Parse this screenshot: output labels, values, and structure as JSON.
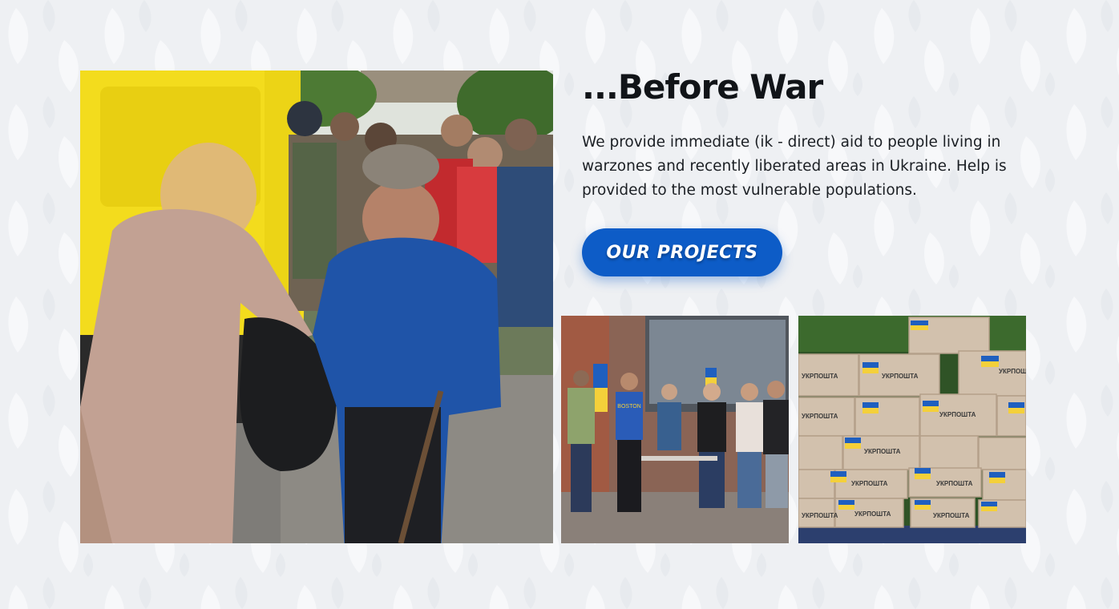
{
  "section": {
    "heading": "...Before War",
    "description": "We provide immediate (ik - direct) aid to people living in warzones and recently liberated areas in Ukraine. Help is provided to the most vulnerable populations.",
    "cta_label": "OUR PROJECTS"
  },
  "photos": {
    "team_shirt_text": "BOSTON",
    "box_label": "УКРПОШТА"
  },
  "colors": {
    "background": "#eef0f3",
    "heading": "#111418",
    "body_text": "#1b1f24",
    "button": "#0d5cc7",
    "button_text": "#ffffff",
    "ukraine_blue": "#1f5fbf",
    "ukraine_yellow": "#f4d03a"
  }
}
